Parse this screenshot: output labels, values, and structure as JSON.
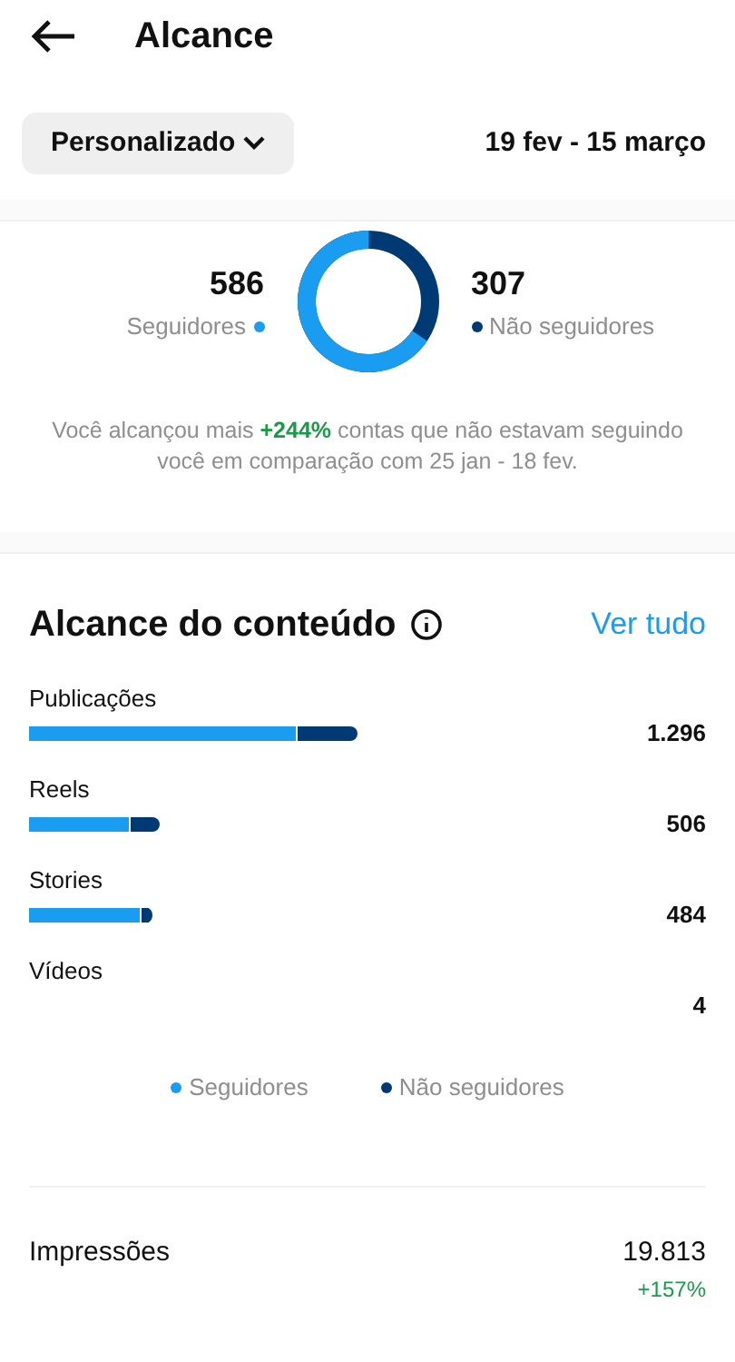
{
  "header": {
    "title": "Alcance"
  },
  "filter": {
    "label": "Personalizado",
    "date_range": "19 fev - 15 março"
  },
  "audience": {
    "followers": {
      "value": "586",
      "label": "Seguidores",
      "color": "#1a9cf0"
    },
    "non_followers": {
      "value": "307",
      "label": "Não seguidores",
      "color": "#003a75"
    },
    "summary": "Você alcançou mais **+244%** contas que não estavam seguindo você em comparação com 25 jan - 18 fev."
  },
  "content_reach": {
    "title": "Alcance do conteúdo",
    "see_all": "Ver tudo",
    "rows": [
      {
        "label": "Publicações",
        "value": "1.296"
      },
      {
        "label": "Reels",
        "value": "506"
      },
      {
        "label": "Stories",
        "value": "484"
      },
      {
        "label": "Vídeos",
        "value": "4"
      }
    ],
    "legend": [
      {
        "label": "Seguidores",
        "color": "#1a9cf0"
      },
      {
        "label": "Não seguidores",
        "color": "#003a75"
      }
    ]
  },
  "impressions": {
    "label": "Impressões",
    "value": "19.813",
    "change": "+157%"
  }
}
